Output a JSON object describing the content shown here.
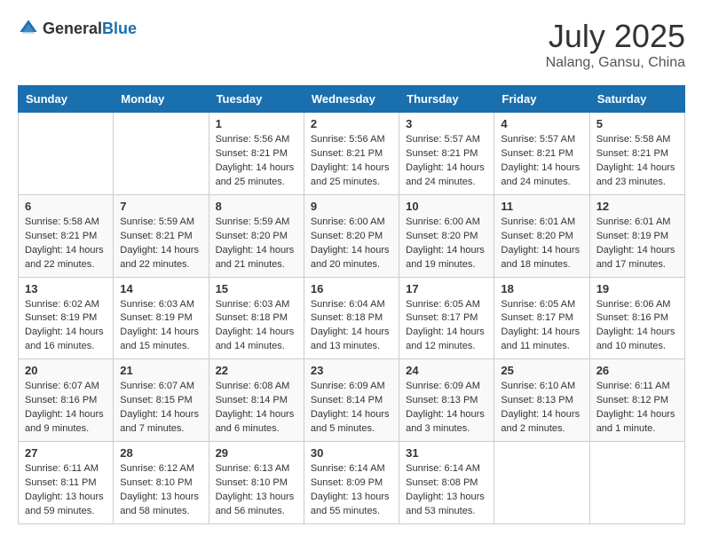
{
  "header": {
    "logo_general": "General",
    "logo_blue": "Blue",
    "month": "July 2025",
    "location": "Nalang, Gansu, China"
  },
  "weekdays": [
    "Sunday",
    "Monday",
    "Tuesday",
    "Wednesday",
    "Thursday",
    "Friday",
    "Saturday"
  ],
  "weeks": [
    [
      {
        "day": "",
        "info": ""
      },
      {
        "day": "",
        "info": ""
      },
      {
        "day": "1",
        "info": "Sunrise: 5:56 AM\nSunset: 8:21 PM\nDaylight: 14 hours and 25 minutes."
      },
      {
        "day": "2",
        "info": "Sunrise: 5:56 AM\nSunset: 8:21 PM\nDaylight: 14 hours and 25 minutes."
      },
      {
        "day": "3",
        "info": "Sunrise: 5:57 AM\nSunset: 8:21 PM\nDaylight: 14 hours and 24 minutes."
      },
      {
        "day": "4",
        "info": "Sunrise: 5:57 AM\nSunset: 8:21 PM\nDaylight: 14 hours and 24 minutes."
      },
      {
        "day": "5",
        "info": "Sunrise: 5:58 AM\nSunset: 8:21 PM\nDaylight: 14 hours and 23 minutes."
      }
    ],
    [
      {
        "day": "6",
        "info": "Sunrise: 5:58 AM\nSunset: 8:21 PM\nDaylight: 14 hours and 22 minutes."
      },
      {
        "day": "7",
        "info": "Sunrise: 5:59 AM\nSunset: 8:21 PM\nDaylight: 14 hours and 22 minutes."
      },
      {
        "day": "8",
        "info": "Sunrise: 5:59 AM\nSunset: 8:20 PM\nDaylight: 14 hours and 21 minutes."
      },
      {
        "day": "9",
        "info": "Sunrise: 6:00 AM\nSunset: 8:20 PM\nDaylight: 14 hours and 20 minutes."
      },
      {
        "day": "10",
        "info": "Sunrise: 6:00 AM\nSunset: 8:20 PM\nDaylight: 14 hours and 19 minutes."
      },
      {
        "day": "11",
        "info": "Sunrise: 6:01 AM\nSunset: 8:20 PM\nDaylight: 14 hours and 18 minutes."
      },
      {
        "day": "12",
        "info": "Sunrise: 6:01 AM\nSunset: 8:19 PM\nDaylight: 14 hours and 17 minutes."
      }
    ],
    [
      {
        "day": "13",
        "info": "Sunrise: 6:02 AM\nSunset: 8:19 PM\nDaylight: 14 hours and 16 minutes."
      },
      {
        "day": "14",
        "info": "Sunrise: 6:03 AM\nSunset: 8:19 PM\nDaylight: 14 hours and 15 minutes."
      },
      {
        "day": "15",
        "info": "Sunrise: 6:03 AM\nSunset: 8:18 PM\nDaylight: 14 hours and 14 minutes."
      },
      {
        "day": "16",
        "info": "Sunrise: 6:04 AM\nSunset: 8:18 PM\nDaylight: 14 hours and 13 minutes."
      },
      {
        "day": "17",
        "info": "Sunrise: 6:05 AM\nSunset: 8:17 PM\nDaylight: 14 hours and 12 minutes."
      },
      {
        "day": "18",
        "info": "Sunrise: 6:05 AM\nSunset: 8:17 PM\nDaylight: 14 hours and 11 minutes."
      },
      {
        "day": "19",
        "info": "Sunrise: 6:06 AM\nSunset: 8:16 PM\nDaylight: 14 hours and 10 minutes."
      }
    ],
    [
      {
        "day": "20",
        "info": "Sunrise: 6:07 AM\nSunset: 8:16 PM\nDaylight: 14 hours and 9 minutes."
      },
      {
        "day": "21",
        "info": "Sunrise: 6:07 AM\nSunset: 8:15 PM\nDaylight: 14 hours and 7 minutes."
      },
      {
        "day": "22",
        "info": "Sunrise: 6:08 AM\nSunset: 8:14 PM\nDaylight: 14 hours and 6 minutes."
      },
      {
        "day": "23",
        "info": "Sunrise: 6:09 AM\nSunset: 8:14 PM\nDaylight: 14 hours and 5 minutes."
      },
      {
        "day": "24",
        "info": "Sunrise: 6:09 AM\nSunset: 8:13 PM\nDaylight: 14 hours and 3 minutes."
      },
      {
        "day": "25",
        "info": "Sunrise: 6:10 AM\nSunset: 8:13 PM\nDaylight: 14 hours and 2 minutes."
      },
      {
        "day": "26",
        "info": "Sunrise: 6:11 AM\nSunset: 8:12 PM\nDaylight: 14 hours and 1 minute."
      }
    ],
    [
      {
        "day": "27",
        "info": "Sunrise: 6:11 AM\nSunset: 8:11 PM\nDaylight: 13 hours and 59 minutes."
      },
      {
        "day": "28",
        "info": "Sunrise: 6:12 AM\nSunset: 8:10 PM\nDaylight: 13 hours and 58 minutes."
      },
      {
        "day": "29",
        "info": "Sunrise: 6:13 AM\nSunset: 8:10 PM\nDaylight: 13 hours and 56 minutes."
      },
      {
        "day": "30",
        "info": "Sunrise: 6:14 AM\nSunset: 8:09 PM\nDaylight: 13 hours and 55 minutes."
      },
      {
        "day": "31",
        "info": "Sunrise: 6:14 AM\nSunset: 8:08 PM\nDaylight: 13 hours and 53 minutes."
      },
      {
        "day": "",
        "info": ""
      },
      {
        "day": "",
        "info": ""
      }
    ]
  ]
}
